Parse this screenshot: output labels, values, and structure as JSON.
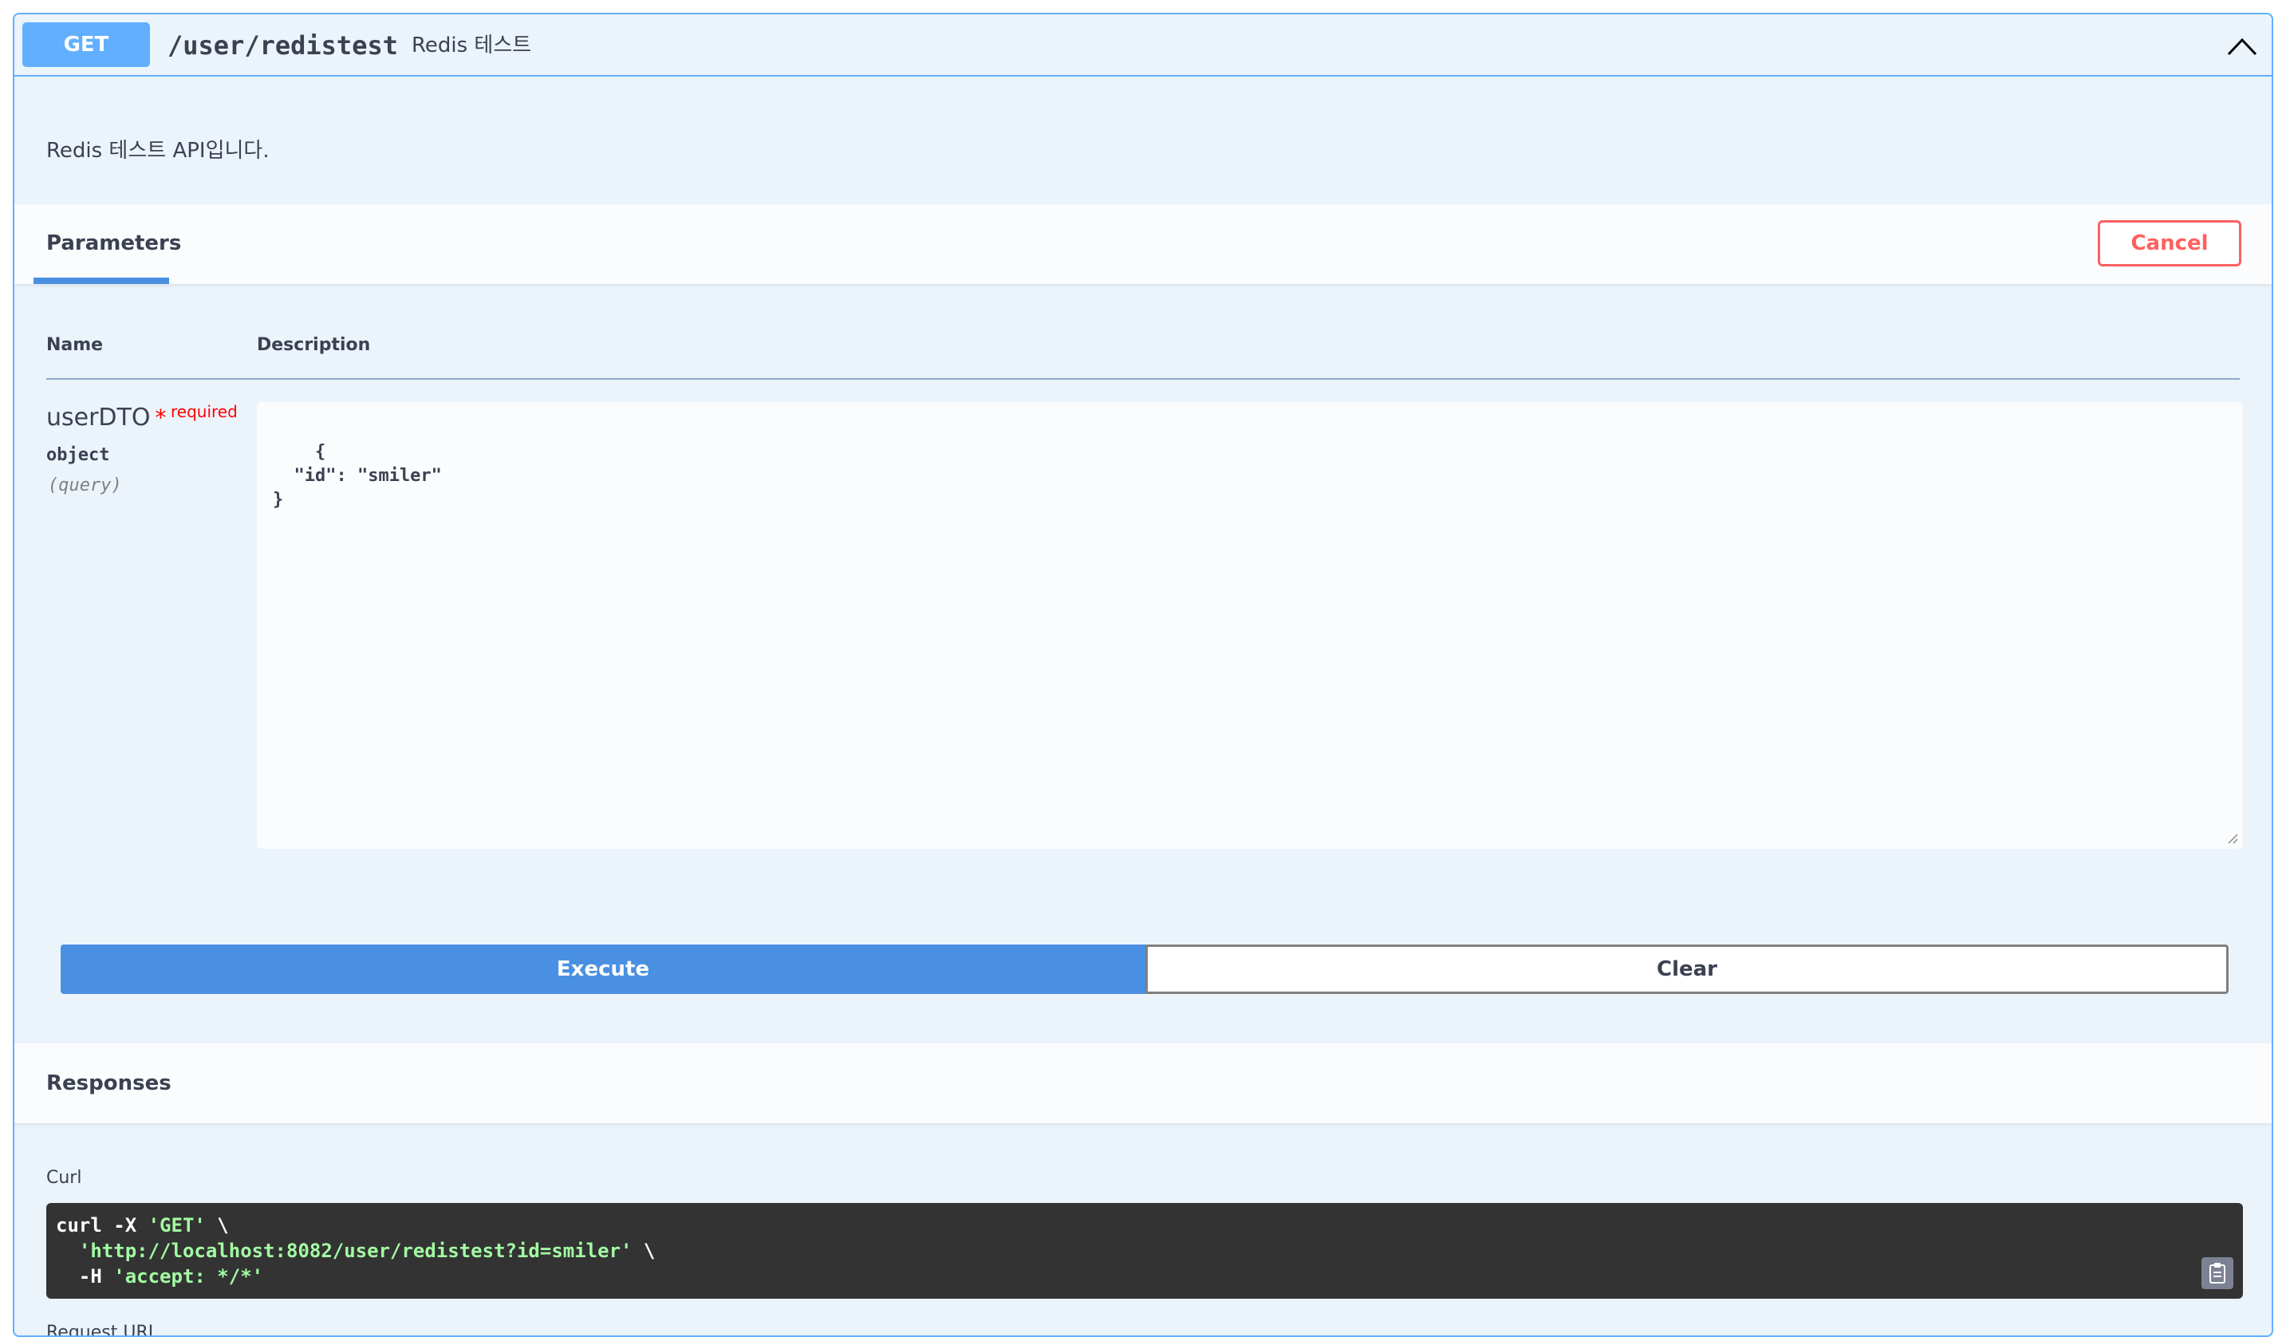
{
  "operation": {
    "method": "GET",
    "path": "/user/redistest",
    "summary": "Redis 테스트",
    "description": "Redis 테스트 API입니다."
  },
  "parameters": {
    "tab_label": "Parameters",
    "cancel_label": "Cancel",
    "columns": [
      "Name",
      "Description"
    ],
    "items": [
      {
        "name": "userDTO",
        "required_star": "*",
        "required_label": "required",
        "type": "object",
        "in": "(query)",
        "value": "{\n  \"id\": \"smiler\"\n}"
      }
    ]
  },
  "actions": {
    "execute_label": "Execute",
    "clear_label": "Clear"
  },
  "responses": {
    "title": "Responses",
    "curl_label": "Curl",
    "curl": {
      "line1_cmd": "curl -X ",
      "line1_method": "'GET'",
      "line1_tail": " \\",
      "line2_indent": "  ",
      "line2_url": "'http://localhost:8082/user/redistest?id=smiler'",
      "line2_tail": " \\",
      "line3_cmd": "  -H ",
      "line3_header": "'accept: */*'"
    },
    "request_url_label": "Request URL"
  },
  "colors": {
    "get_blue": "#61affe",
    "execute_blue": "#4990e2",
    "cancel_red": "#ff6060",
    "curl_bg": "#333333",
    "curl_string": "#a2fca2"
  },
  "icons": {
    "collapse": "chevron-up-icon",
    "copy": "clipboard-icon"
  }
}
